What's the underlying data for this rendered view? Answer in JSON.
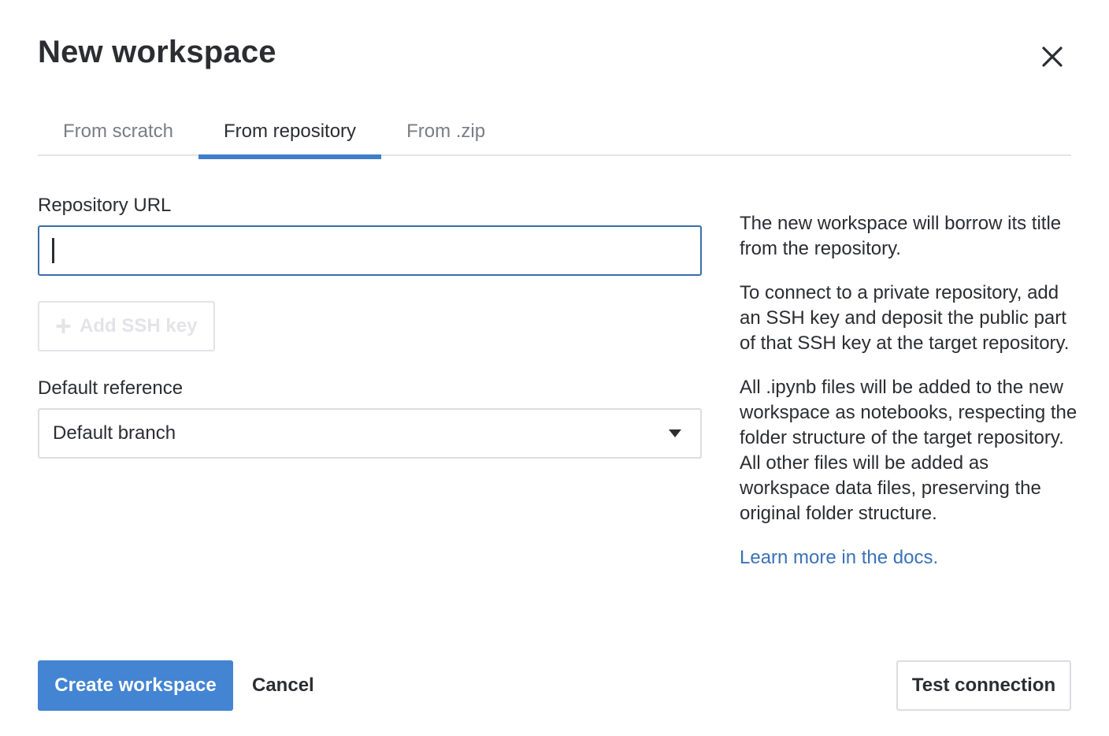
{
  "dialog": {
    "title": "New workspace",
    "close_icon": "close-icon"
  },
  "tabs": [
    {
      "label": "From scratch",
      "active": false
    },
    {
      "label": "From repository",
      "active": true
    },
    {
      "label": "From .zip",
      "active": false
    }
  ],
  "form": {
    "repo_url_label": "Repository URL",
    "repo_url_value": "",
    "add_ssh_label": "Add SSH key",
    "add_ssh_icon": "plus-icon",
    "default_ref_label": "Default reference",
    "default_ref_value": "Default branch",
    "dropdown_icon": "caret-down-icon"
  },
  "help": {
    "p1": "The new workspace will borrow its title from the repository.",
    "p2": "To connect to a private repository, add an SSH key and deposit the public part of that SSH key at the target repository.",
    "p3": "All .ipynb files will be added to the new workspace as notebooks, respecting the folder structure of the target repository. All other files will be added as workspace data files, preserving the original folder structure.",
    "link": "Learn more in the docs."
  },
  "footer": {
    "create_label": "Create workspace",
    "cancel_label": "Cancel",
    "test_label": "Test connection"
  },
  "colors": {
    "accent": "#4384d3",
    "link": "#3a72b8",
    "input_focus_border": "#3a6ea8"
  }
}
